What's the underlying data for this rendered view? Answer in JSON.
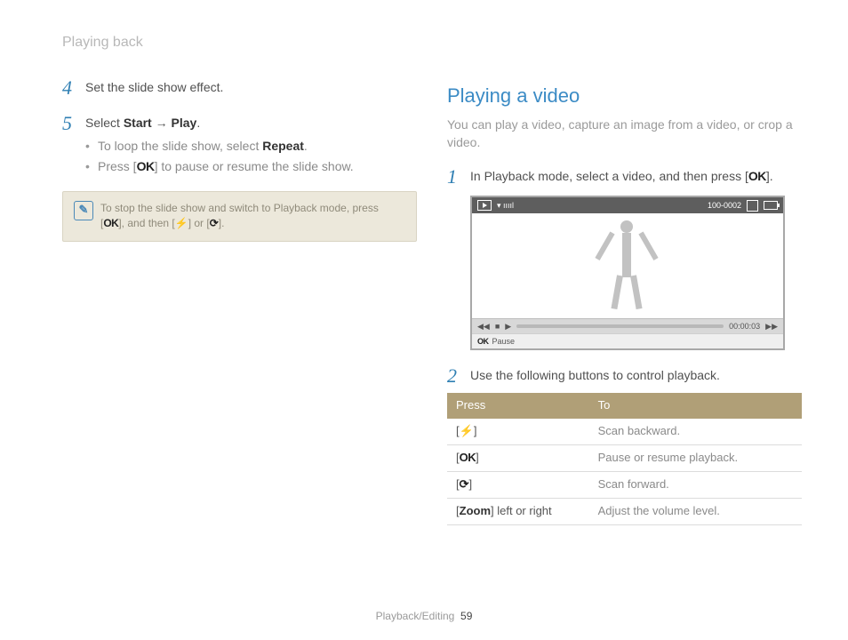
{
  "breadcrumb": "Playing back",
  "left": {
    "step4": {
      "num": "4",
      "text": "Set the slide show effect."
    },
    "step5": {
      "num": "5",
      "prefix": "Select ",
      "b1": "Start",
      "arrow": " → ",
      "b2": "Play",
      "suffix": "."
    },
    "bullets": {
      "a_pre": "To loop the slide show, select ",
      "a_b": "Repeat",
      "a_post": ".",
      "b_pre": "Press [",
      "b_ok": "OK",
      "b_post": "] to pause or resume the slide show."
    },
    "note": {
      "pre": "To stop the slide show and switch to Playback mode, press [",
      "ok": "OK",
      "mid": "], and then [",
      "bolt": "⚡",
      "mid2": "] or [",
      "timer": "⟳",
      "post": "]."
    }
  },
  "right": {
    "heading": "Playing a video",
    "desc": "You can play a video, capture an image from a video, or crop a video.",
    "step1": {
      "num": "1",
      "text": "In Playback mode, select a video, and then press [",
      "ok": "OK",
      "post": "]."
    },
    "screen": {
      "counter": "100-0002",
      "time": "00:00:03",
      "barOK": "OK",
      "barLabel": "Pause"
    },
    "step2": {
      "num": "2",
      "text": "Use the following buttons to control playback."
    },
    "table": {
      "h1": "Press",
      "h2": "To",
      "rows": [
        {
          "k_pre": "[",
          "k": "⚡",
          "k_post": "]",
          "v": "Scan backward."
        },
        {
          "k_pre": "[",
          "k": "OK",
          "k_post": "]",
          "v": "Pause or resume playback."
        },
        {
          "k_pre": "[",
          "k": "⟳",
          "k_post": "]",
          "v": "Scan forward."
        },
        {
          "k_pre": "[",
          "k": "Zoom",
          "k_post": "] left or right",
          "v": "Adjust the volume level."
        }
      ]
    }
  },
  "footer": {
    "section": "Playback/Editing",
    "page": "59"
  }
}
